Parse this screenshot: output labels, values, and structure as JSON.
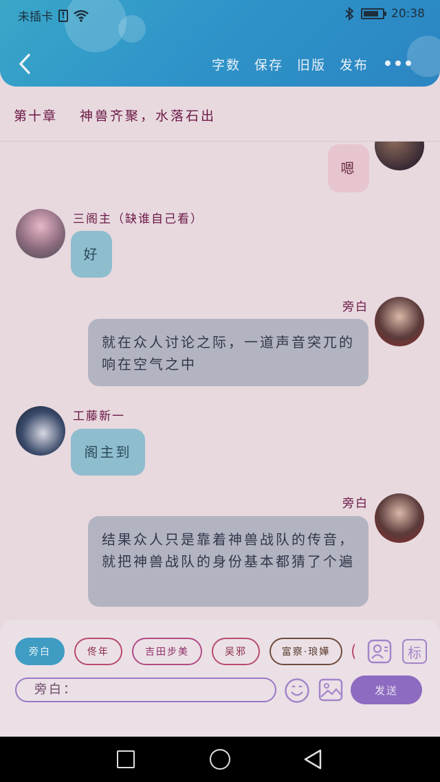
{
  "status_bar": {
    "carrier": "未插卡",
    "time": "20:38",
    "battery_level": 0.8
  },
  "toolbar": {
    "actions": [
      "字数",
      "保存",
      "旧版",
      "发布"
    ]
  },
  "chapter": {
    "number": "第十章",
    "title": "神兽齐聚，水落石出"
  },
  "messages": [
    {
      "side": "right",
      "name": "",
      "text": "嗯",
      "style": "pink"
    },
    {
      "side": "left",
      "name": "三阁主（缺谁自己看）",
      "text": "好",
      "style": "blue"
    },
    {
      "side": "right",
      "name": "旁白",
      "text": "就在众人讨论之际，一道声音突兀的响在空气之中",
      "style": "gray"
    },
    {
      "side": "left",
      "name": "工藤新一",
      "text": "阁主到",
      "style": "blue"
    },
    {
      "side": "right",
      "name": "旁白",
      "text": "结果众人只是靠着神兽战队的传音，就把神兽战队的身份基本都猜了个遍",
      "style": "gray"
    }
  ],
  "role_tags": [
    "旁白",
    "佟年",
    "吉田步美",
    "吴邪",
    "富察·琅嬅"
  ],
  "composer": {
    "input_placeholder": "旁白：",
    "send_label": "发送",
    "mark_label": "标"
  },
  "colors": {
    "header": "#2f94c9",
    "accent_purple": "#8d6bc0",
    "active_tag": "#3f9cc3"
  }
}
